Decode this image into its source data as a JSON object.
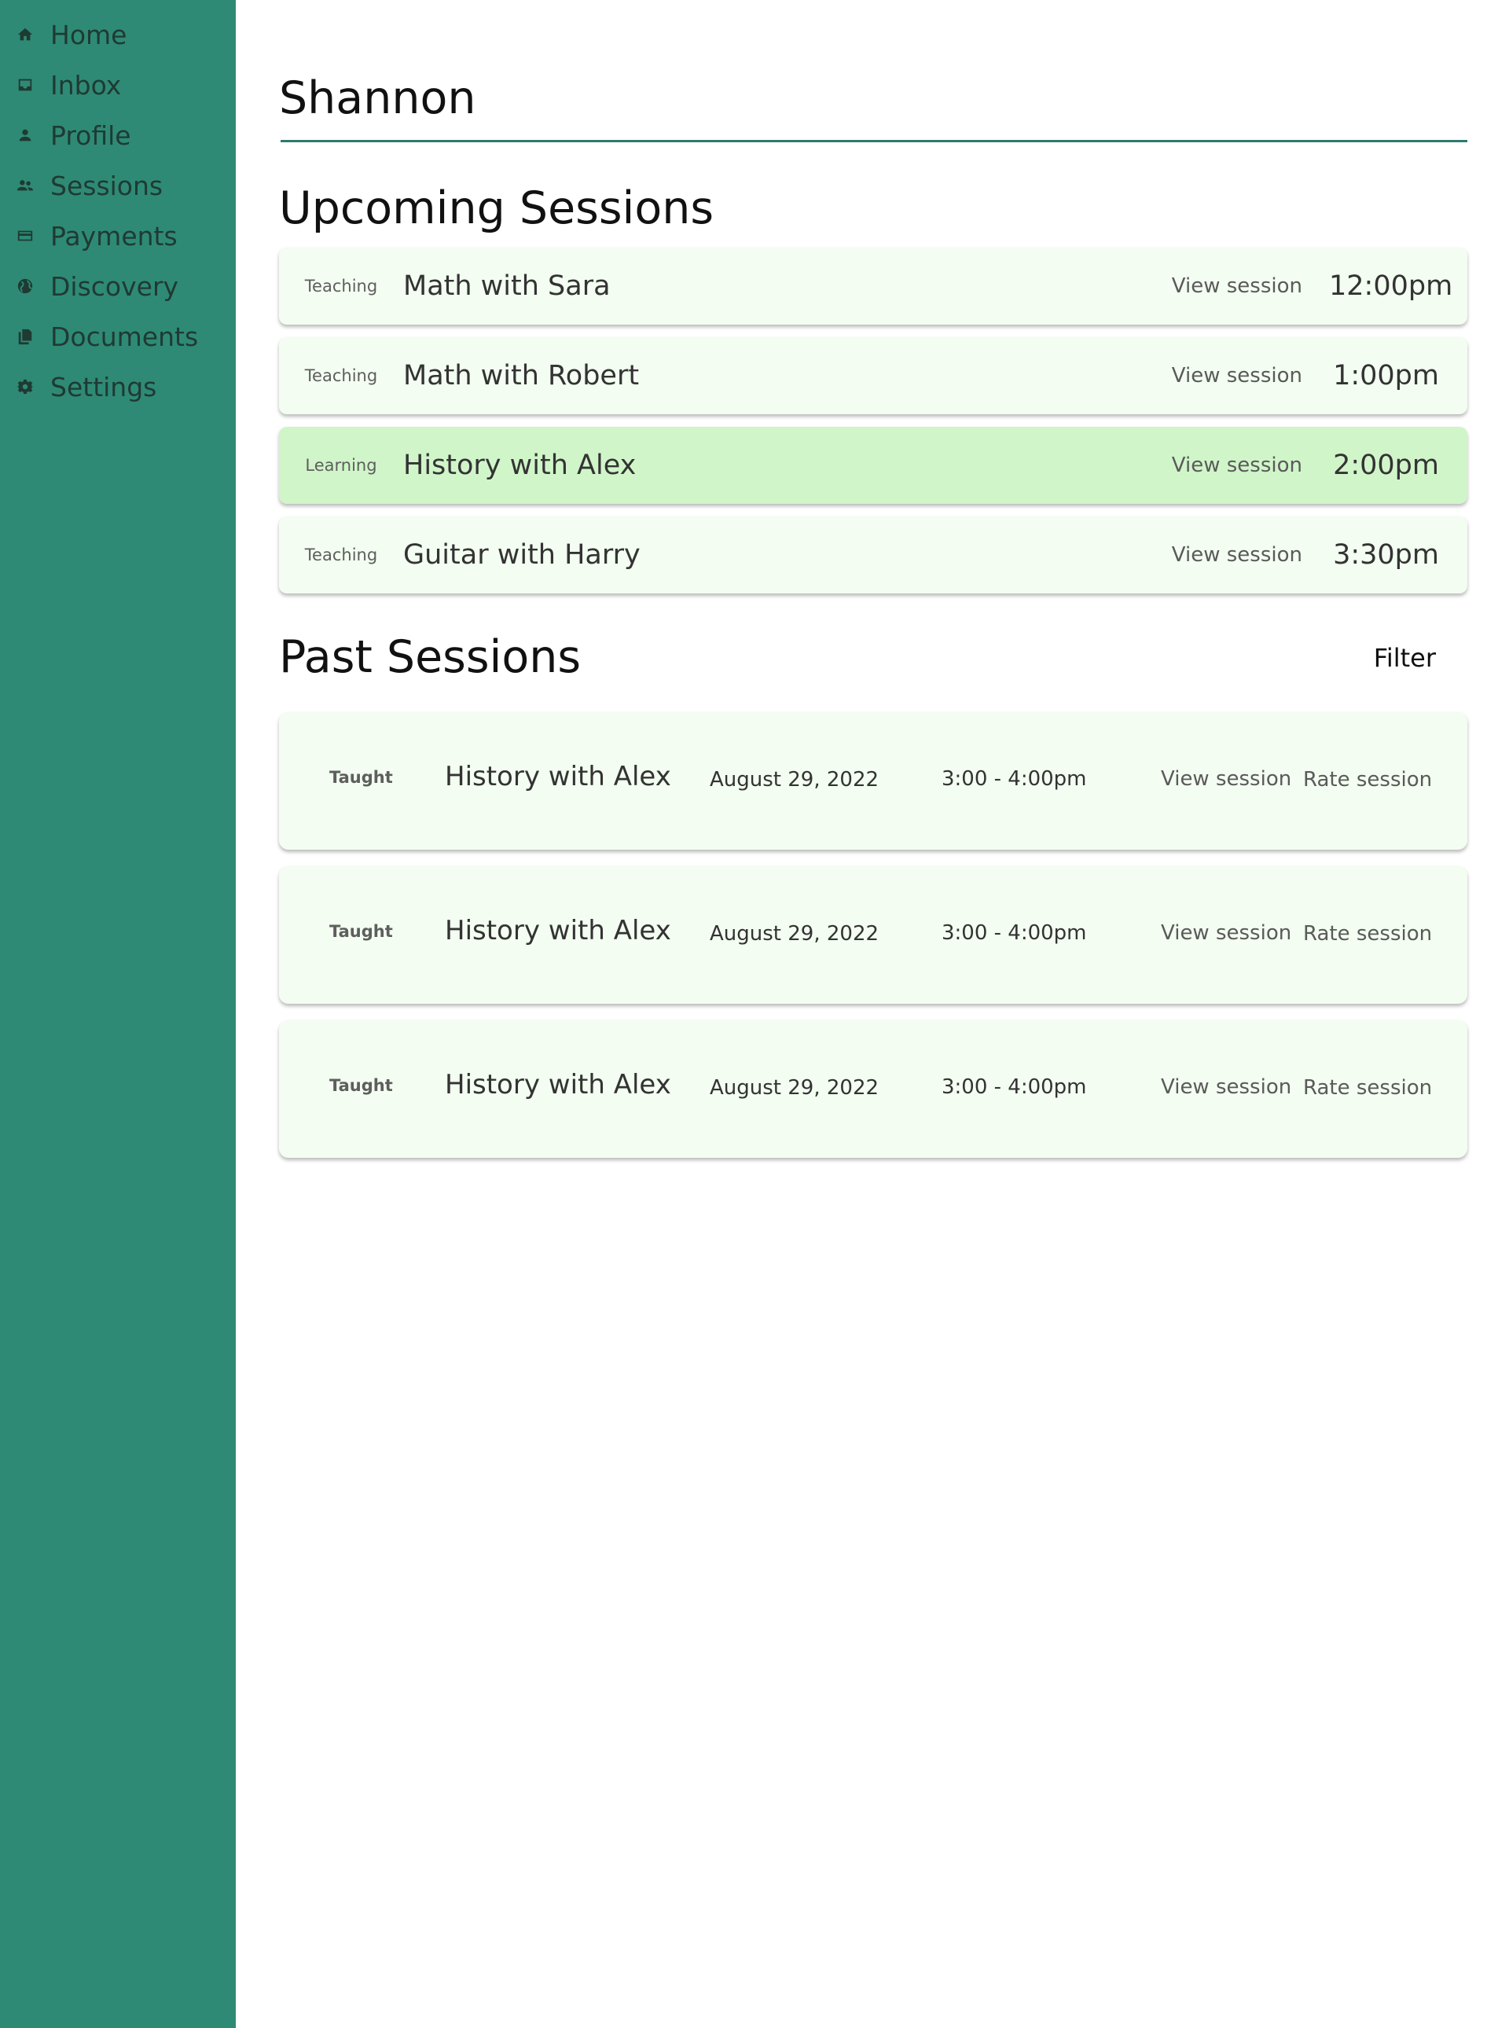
{
  "sidebar": {
    "items": [
      {
        "label": "Home",
        "icon": "home-icon"
      },
      {
        "label": "Inbox",
        "icon": "inbox-icon"
      },
      {
        "label": "Profile",
        "icon": "person-icon"
      },
      {
        "label": "Sessions",
        "icon": "people-icon"
      },
      {
        "label": "Payments",
        "icon": "credit-card-icon"
      },
      {
        "label": "Discovery",
        "icon": "globe-icon"
      },
      {
        "label": "Documents",
        "icon": "documents-icon"
      },
      {
        "label": "Settings",
        "icon": "gear-icon"
      }
    ]
  },
  "header": {
    "title": "Shannon"
  },
  "upcoming": {
    "title": "Upcoming Sessions",
    "sessions": [
      {
        "role": "Teaching",
        "name": "Math with Sara",
        "action": "View session",
        "time": "12:00pm"
      },
      {
        "role": "Teaching",
        "name": "Math with Robert",
        "action": "View session",
        "time": "1:00pm"
      },
      {
        "role": "Learning",
        "name": "History with Alex",
        "action": "View session",
        "time": "2:00pm"
      },
      {
        "role": "Teaching",
        "name": "Guitar with Harry",
        "action": "View session",
        "time": "3:30pm"
      }
    ]
  },
  "past": {
    "title": "Past Sessions",
    "filter_label": "Filter",
    "sessions": [
      {
        "role": "Taught",
        "name": "History with Alex",
        "date": "August 29, 2022",
        "time": "3:00 - 4:00pm",
        "view": "View session",
        "rate": "Rate session"
      },
      {
        "role": "Taught",
        "name": "History with Alex",
        "date": "August 29, 2022",
        "time": "3:00 - 4:00pm",
        "view": "View session",
        "rate": "Rate session"
      },
      {
        "role": "Taught",
        "name": "History with Alex",
        "date": "August 29, 2022",
        "time": "3:00 - 4:00pm",
        "view": "View session",
        "rate": "Rate session"
      }
    ]
  },
  "colors": {
    "sidebar": "#2e8a75",
    "card": "#f3fdf1",
    "card_highlight": "#d0f5c9",
    "rule": "#2e7a70"
  }
}
